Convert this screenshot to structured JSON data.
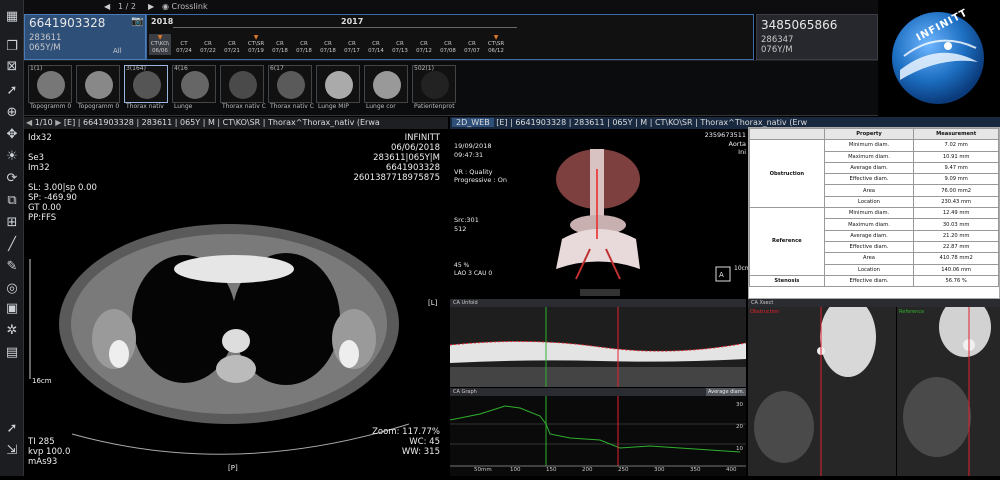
{
  "topbar": {
    "pager": "1 / 2",
    "crosslink": "Crosslink"
  },
  "patient_current": {
    "id": "6641903328",
    "code": "283611",
    "age_sex": "065Y/M",
    "filter": "All"
  },
  "patient_other": {
    "id": "3485065866",
    "code": "286347",
    "age_sex": "076Y/M"
  },
  "timeline": {
    "years": [
      "2018",
      "2017"
    ],
    "studies": [
      {
        "top": "CT\\KO\\",
        "date": "06/06"
      },
      {
        "top": "CT",
        "date": "07/24"
      },
      {
        "top": "CR",
        "date": "07/22"
      },
      {
        "top": "CR",
        "date": "07/21"
      },
      {
        "top": "CT\\SR",
        "date": "07/19"
      },
      {
        "top": "CR",
        "date": "07/18"
      },
      {
        "top": "CR",
        "date": "07/18"
      },
      {
        "top": "CR",
        "date": "07/18"
      },
      {
        "top": "CR",
        "date": "07/17"
      },
      {
        "top": "CR",
        "date": "07/14"
      },
      {
        "top": "CR",
        "date": "07/13"
      },
      {
        "top": "CR",
        "date": "07/12"
      },
      {
        "top": "CR",
        "date": "07/08"
      },
      {
        "top": "CR",
        "date": "07/07"
      },
      {
        "top": "CT\\SR",
        "date": "06/12"
      }
    ]
  },
  "thumbnails": [
    {
      "count": "1(1)",
      "label": "Topogramm  0"
    },
    {
      "count": "",
      "label": "Topogramm  0"
    },
    {
      "count": "3(164)",
      "label": "Thorax nativ"
    },
    {
      "count": "4(16",
      "label": "Lunge"
    },
    {
      "count": "",
      "label": "Thorax nativ C"
    },
    {
      "count": "6(17",
      "label": "Thorax nativ C"
    },
    {
      "count": "",
      "label": "Lunge MIP"
    },
    {
      "count": "",
      "label": "Lunge cor"
    },
    {
      "count": "502(1)",
      "label": "Patientenprot"
    }
  ],
  "logo": {
    "text": "INFINITT",
    "color": "#1d6fc2"
  },
  "viewer_left": {
    "series_pos": "1/10",
    "header": "[E] | 6641903328 | 283611 | 065Y | M | CT\\KO\\SR | Thorax^Thorax_nativ (Erwa",
    "tl": [
      "Idx32",
      "",
      "Se3",
      "Im32",
      "",
      "SL: 3.00|sp 0.00",
      "SP: -469.90",
      "GT 0.00",
      "PP:FFS"
    ],
    "tr": [
      "INFINITT",
      "06/06/2018",
      "283611|065Y|M",
      "6641903328",
      "2601387718975875"
    ],
    "bl": [
      "TI 285",
      "kvp 100.0",
      "mAs93"
    ],
    "br": [
      "Zoom: 117.77%",
      "WC: 45",
      "WW: 315"
    ],
    "scale": "16cm",
    "orient_right": "[L]",
    "orient_bottom": "[P]"
  },
  "viewer_right": {
    "tab": "2D_WEB",
    "header": "[E] | 6641903328 | 283611 | 065Y | M | CT\\KO\\SR | Thorax^Thorax_nativ (Erw",
    "tl": [
      "19/09/2018",
      "09:47:31",
      "",
      "VR : Quality",
      "Progressive : On"
    ],
    "mid_left": [
      "Src:301",
      "512"
    ],
    "bottom_left": [
      "45 %",
      "LAO 3 CAU 0"
    ],
    "tr": [
      "2359673511",
      "Aorta",
      "Ini"
    ],
    "scale": "10cm",
    "orient": "A"
  },
  "measurement_table": {
    "headers": [
      "",
      "Property",
      "Measurement"
    ],
    "groups": [
      {
        "name": "Obstruction",
        "rows": [
          [
            "Minimum diam.",
            "7.02 mm"
          ],
          [
            "Maximum diam.",
            "10.91 mm"
          ],
          [
            "Average diam.",
            "9.47 mm"
          ],
          [
            "Effective diam.",
            "9.09 mm"
          ],
          [
            "Area",
            "76.00 mm2"
          ],
          [
            "Location",
            "230.43 mm"
          ]
        ]
      },
      {
        "name": "Reference",
        "rows": [
          [
            "Minimum diam.",
            "12.49 mm"
          ],
          [
            "Maximum diam.",
            "30.03 mm"
          ],
          [
            "Average diam.",
            "21.20 mm"
          ],
          [
            "Effective diam.",
            "22.87 mm"
          ],
          [
            "Area",
            "410.78 mm2"
          ],
          [
            "Location",
            "140.06 mm"
          ]
        ]
      },
      {
        "name": "Stenosis",
        "rows": [
          [
            "Effective diam.",
            "56.76 %"
          ]
        ]
      }
    ]
  },
  "subpanels": {
    "cpr_label": "CA Unfold",
    "xsec_label": "CA Xsect",
    "graph_label": "CA Graph",
    "graph_dropdown": "Average diam.",
    "obstruction_label": "Obstruction",
    "reference_label": "Reference",
    "graph_axis": [
      "50mm",
      "100",
      "150",
      "200",
      "250",
      "300",
      "350",
      "400"
    ],
    "graph_y": [
      "30",
      "20",
      "10"
    ]
  },
  "colors": {
    "accent": "#3b6aa8",
    "marker_red": "#e0232e",
    "graph_green": "#2fb12f"
  }
}
